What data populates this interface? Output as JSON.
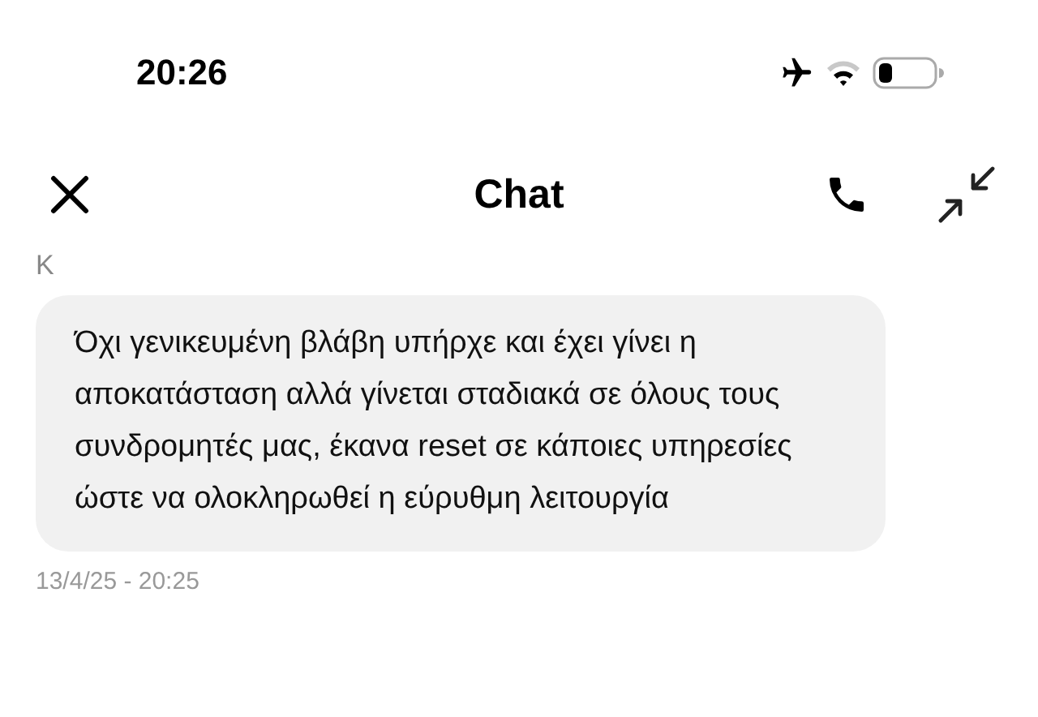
{
  "status_bar": {
    "time": "20:26"
  },
  "header": {
    "title": "Chat"
  },
  "message": {
    "sender": "Κ",
    "text": "Όχι γενικευμένη βλάβη υπήρχε και έχει γίνει η αποκατάσταση αλλά γίνεται σταδιακά σε όλους τους συνδρομητές μας, έκανα reset σε κάποιες υπηρεσίες ώστε να ολοκληρωθεί η εύρυθμη λειτουργία",
    "timestamp": "13/4/25 - 20:25"
  }
}
